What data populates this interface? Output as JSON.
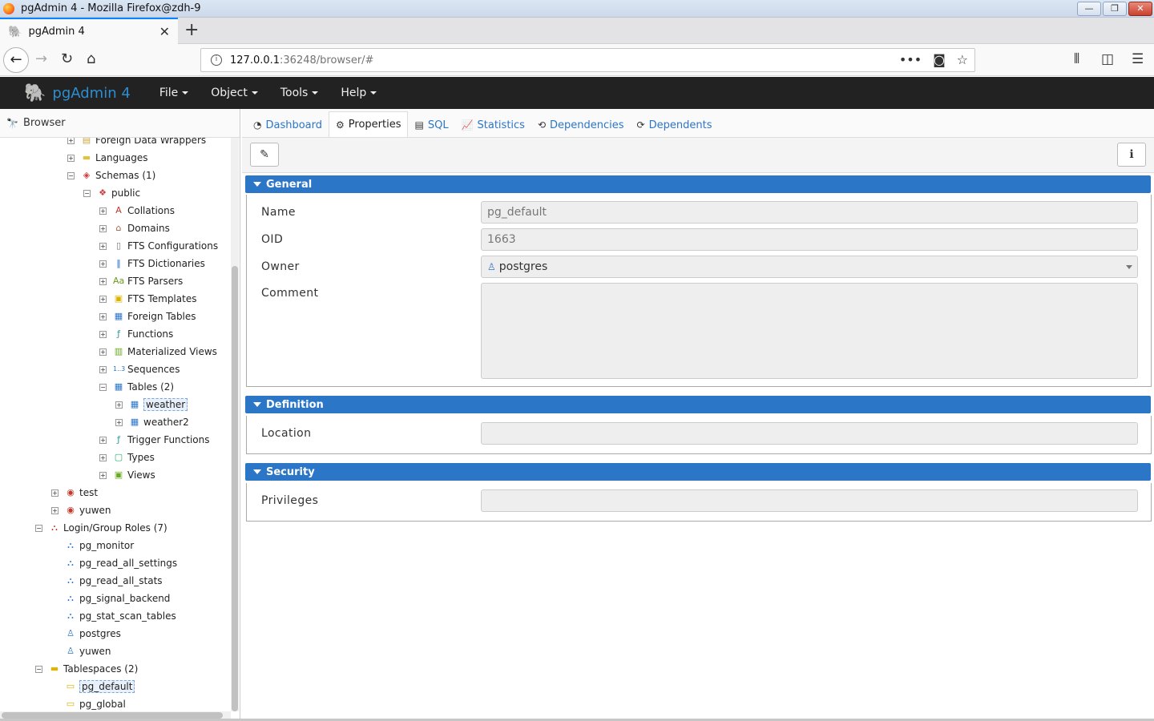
{
  "window": {
    "title": "pgAdmin 4 - Mozilla Firefox@zdh-9",
    "minimize": "—",
    "restore": "❐",
    "close": "✕"
  },
  "tab": {
    "title": "pgAdmin 4"
  },
  "url": {
    "host": "127.0.0.1",
    "rest": ":36248/browser/#"
  },
  "app": {
    "brand": "pgAdmin 4",
    "menu": [
      "File",
      "Object",
      "Tools",
      "Help"
    ]
  },
  "browser": {
    "title": "Browser",
    "tree": [
      {
        "label": "Foreign Data Wrappers",
        "indent": 1,
        "exp": "+",
        "icon": "folder-icon",
        "color": "#c8a23a",
        "glyph": "▤"
      },
      {
        "label": "Languages",
        "indent": 1,
        "exp": "+",
        "icon": "folder-icon",
        "color": "#e0c23c",
        "glyph": "▬"
      },
      {
        "label": "Schemas (1)",
        "indent": 1,
        "exp": "−",
        "icon": "schema-icon",
        "color": "#d23c3c",
        "glyph": "◈"
      },
      {
        "label": "public",
        "indent": 2,
        "exp": "−",
        "icon": "schema-icon",
        "color": "#d23c3c",
        "glyph": "❖"
      },
      {
        "label": "Collations",
        "indent": 3,
        "exp": "+",
        "icon": "collation-icon",
        "color": "#c0392b",
        "glyph": "A"
      },
      {
        "label": "Domains",
        "indent": 3,
        "exp": "+",
        "icon": "domain-icon",
        "color": "#a06040",
        "glyph": "⌂"
      },
      {
        "label": "FTS Configurations",
        "indent": 3,
        "exp": "+",
        "icon": "fts-config-icon",
        "color": "#777",
        "glyph": "▯"
      },
      {
        "label": "FTS Dictionaries",
        "indent": 3,
        "exp": "+",
        "icon": "fts-dict-icon",
        "color": "#2c76c7",
        "glyph": "‖"
      },
      {
        "label": "FTS Parsers",
        "indent": 3,
        "exp": "+",
        "icon": "fts-parser-icon",
        "color": "#6a9a1f",
        "glyph": "Aa"
      },
      {
        "label": "FTS Templates",
        "indent": 3,
        "exp": "+",
        "icon": "fts-template-icon",
        "color": "#d8b400",
        "glyph": "▣"
      },
      {
        "label": "Foreign Tables",
        "indent": 3,
        "exp": "+",
        "icon": "foreign-table-icon",
        "color": "#2c76c7",
        "glyph": "▦"
      },
      {
        "label": "Functions",
        "indent": 3,
        "exp": "+",
        "icon": "function-icon",
        "color": "#2c9c9c",
        "glyph": "ƒ"
      },
      {
        "label": "Materialized Views",
        "indent": 3,
        "exp": "+",
        "icon": "mview-icon",
        "color": "#6aa81f",
        "glyph": "▥"
      },
      {
        "label": "Sequences",
        "indent": 3,
        "exp": "+",
        "icon": "sequence-icon",
        "color": "#2c76c7",
        "glyph": "1..3"
      },
      {
        "label": "Tables (2)",
        "indent": 3,
        "exp": "−",
        "icon": "table-icon",
        "color": "#2c76c7",
        "glyph": "▦"
      },
      {
        "label": "weather",
        "indent": 4,
        "exp": "+",
        "icon": "table-icon",
        "color": "#2c76c7",
        "glyph": "▦",
        "selected": true
      },
      {
        "label": "weather2",
        "indent": 4,
        "exp": "+",
        "icon": "table-icon",
        "color": "#2c76c7",
        "glyph": "▦"
      },
      {
        "label": "Trigger Functions",
        "indent": 3,
        "exp": "+",
        "icon": "trigger-function-icon",
        "color": "#2c9c9c",
        "glyph": "ƒ"
      },
      {
        "label": "Types",
        "indent": 3,
        "exp": "+",
        "icon": "type-icon",
        "color": "#2cae6e",
        "glyph": "▢"
      },
      {
        "label": "Views",
        "indent": 3,
        "exp": "+",
        "icon": "view-icon",
        "color": "#6aa81f",
        "glyph": "▣"
      },
      {
        "label": "test",
        "indent": 0,
        "exp": "+",
        "icon": "database-icon",
        "color": "#c0392b",
        "glyph": "◉"
      },
      {
        "label": "yuwen",
        "indent": 0,
        "exp": "+",
        "icon": "database-icon",
        "color": "#c0392b",
        "glyph": "◉"
      },
      {
        "label": "Login/Group Roles (7)",
        "indent": -1,
        "exp": "−",
        "icon": "roles-icon",
        "color": "#c0392b",
        "glyph": "⛬"
      },
      {
        "label": "pg_monitor",
        "indent": 0,
        "exp": "",
        "icon": "group-role-icon",
        "color": "#2c76c7",
        "glyph": "⛬"
      },
      {
        "label": "pg_read_all_settings",
        "indent": 0,
        "exp": "",
        "icon": "group-role-icon",
        "color": "#2c76c7",
        "glyph": "⛬"
      },
      {
        "label": "pg_read_all_stats",
        "indent": 0,
        "exp": "",
        "icon": "group-role-icon",
        "color": "#2c76c7",
        "glyph": "⛬"
      },
      {
        "label": "pg_signal_backend",
        "indent": 0,
        "exp": "",
        "icon": "group-role-icon",
        "color": "#2c76c7",
        "glyph": "⛬"
      },
      {
        "label": "pg_stat_scan_tables",
        "indent": 0,
        "exp": "",
        "icon": "group-role-icon",
        "color": "#2c76c7",
        "glyph": "⛬"
      },
      {
        "label": "postgres",
        "indent": 0,
        "exp": "",
        "icon": "user-role-icon",
        "color": "#2c76c7",
        "glyph": "♙"
      },
      {
        "label": "yuwen",
        "indent": 0,
        "exp": "",
        "icon": "user-role-icon",
        "color": "#2c76c7",
        "glyph": "♙"
      },
      {
        "label": "Tablespaces (2)",
        "indent": -1,
        "exp": "−",
        "icon": "tablespaces-icon",
        "color": "#e0b400",
        "glyph": "▬"
      },
      {
        "label": "pg_default",
        "indent": 0,
        "exp": "",
        "icon": "tablespace-icon",
        "color": "#e0b400",
        "glyph": "▭",
        "selected": true
      },
      {
        "label": "pg_global",
        "indent": 0,
        "exp": "",
        "icon": "tablespace-icon",
        "color": "#e0b400",
        "glyph": "▭"
      }
    ]
  },
  "tabs": [
    {
      "label": "Dashboard",
      "icon": "dashboard-icon",
      "glyph": "◔"
    },
    {
      "label": "Properties",
      "icon": "properties-icon",
      "glyph": "⚙",
      "active": true
    },
    {
      "label": "SQL",
      "icon": "sql-icon",
      "glyph": "▤"
    },
    {
      "label": "Statistics",
      "icon": "statistics-icon",
      "glyph": "📈"
    },
    {
      "label": "Dependencies",
      "icon": "dependencies-icon",
      "glyph": "⟲"
    },
    {
      "label": "Dependents",
      "icon": "dependents-icon",
      "glyph": "⟳"
    }
  ],
  "toolbar": {
    "edit_glyph": "✎",
    "info_glyph": "ℹ"
  },
  "sections": {
    "general": {
      "title": "General",
      "name_label": "Name",
      "name_value": "pg_default",
      "oid_label": "OID",
      "oid_value": "1663",
      "owner_label": "Owner",
      "owner_value": "postgres",
      "comment_label": "Comment",
      "comment_value": ""
    },
    "definition": {
      "title": "Definition",
      "location_label": "Location",
      "location_value": ""
    },
    "security": {
      "title": "Security",
      "privileges_label": "Privileges",
      "privileges_value": ""
    }
  },
  "colors": {
    "accent": "#2c76c7",
    "header_bg": "#222222",
    "brand": "#2c8ed0"
  }
}
